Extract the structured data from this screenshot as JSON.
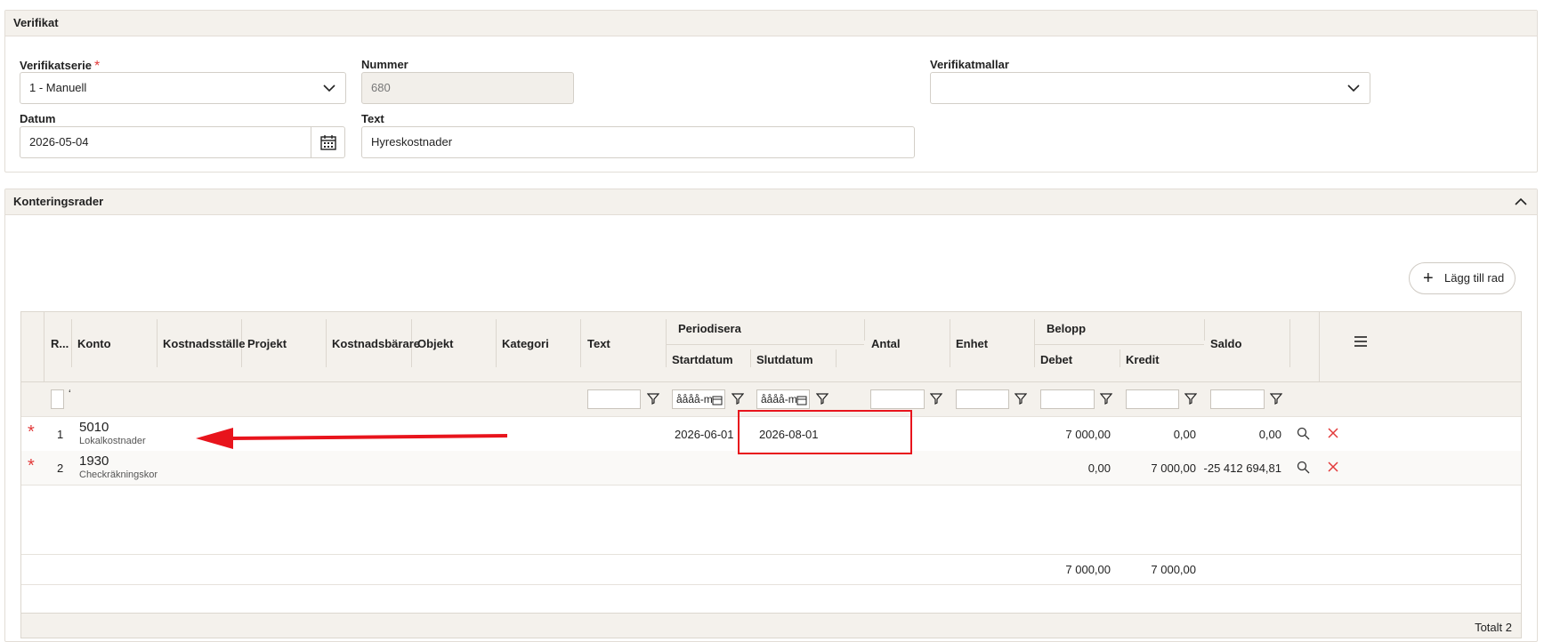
{
  "verifikat": {
    "title": "Verifikat",
    "serie_label": "Verifikatserie",
    "serie_value": "1 - Manuell",
    "nummer_label": "Nummer",
    "nummer_value": "680",
    "mallar_label": "Verifikatmallar",
    "mallar_value": "",
    "datum_label": "Datum",
    "datum_value": "2026-05-04",
    "text_label": "Text",
    "text_value": "Hyreskostnader"
  },
  "kontering": {
    "title": "Konteringsrader",
    "add_label": "Lägg till rad",
    "columns": {
      "row": "R...",
      "konto": "Konto",
      "kostnadsstalle": "Kostnadsställe",
      "projekt": "Projekt",
      "kostnadsbarare": "Kostnadsbärare",
      "objekt": "Objekt",
      "kategori": "Kategori",
      "text": "Text",
      "periodisera": "Periodisera",
      "startdatum": "Startdatum",
      "slutdatum": "Slutdatum",
      "antal": "Antal",
      "enhet": "Enhet",
      "belopp": "Belopp",
      "debet": "Debet",
      "kredit": "Kredit",
      "saldo": "Saldo"
    },
    "filter": {
      "date_placeholder": "åååå-m",
      "row_mark": "ʻ"
    },
    "rows": [
      {
        "nr": "1",
        "konto": "5010",
        "konto_name": "Lokalkostnader",
        "start": "2026-06-01",
        "slut": "2026-08-01",
        "debet": "7 000,00",
        "kredit": "0,00",
        "saldo": "0,00"
      },
      {
        "nr": "2",
        "konto": "1930",
        "konto_name": "Checkräkningskor",
        "start": "",
        "slut": "",
        "debet": "0,00",
        "kredit": "7 000,00",
        "saldo": "-25 412 694,81"
      }
    ],
    "totals": {
      "debet": "7 000,00",
      "kredit": "7 000,00"
    },
    "footer_count": "Totalt 2",
    "required_mark": "*"
  },
  "colors": {
    "header_bg": "#f4f1ec",
    "required": "#e23a3a",
    "annotation": "#e8141c"
  }
}
